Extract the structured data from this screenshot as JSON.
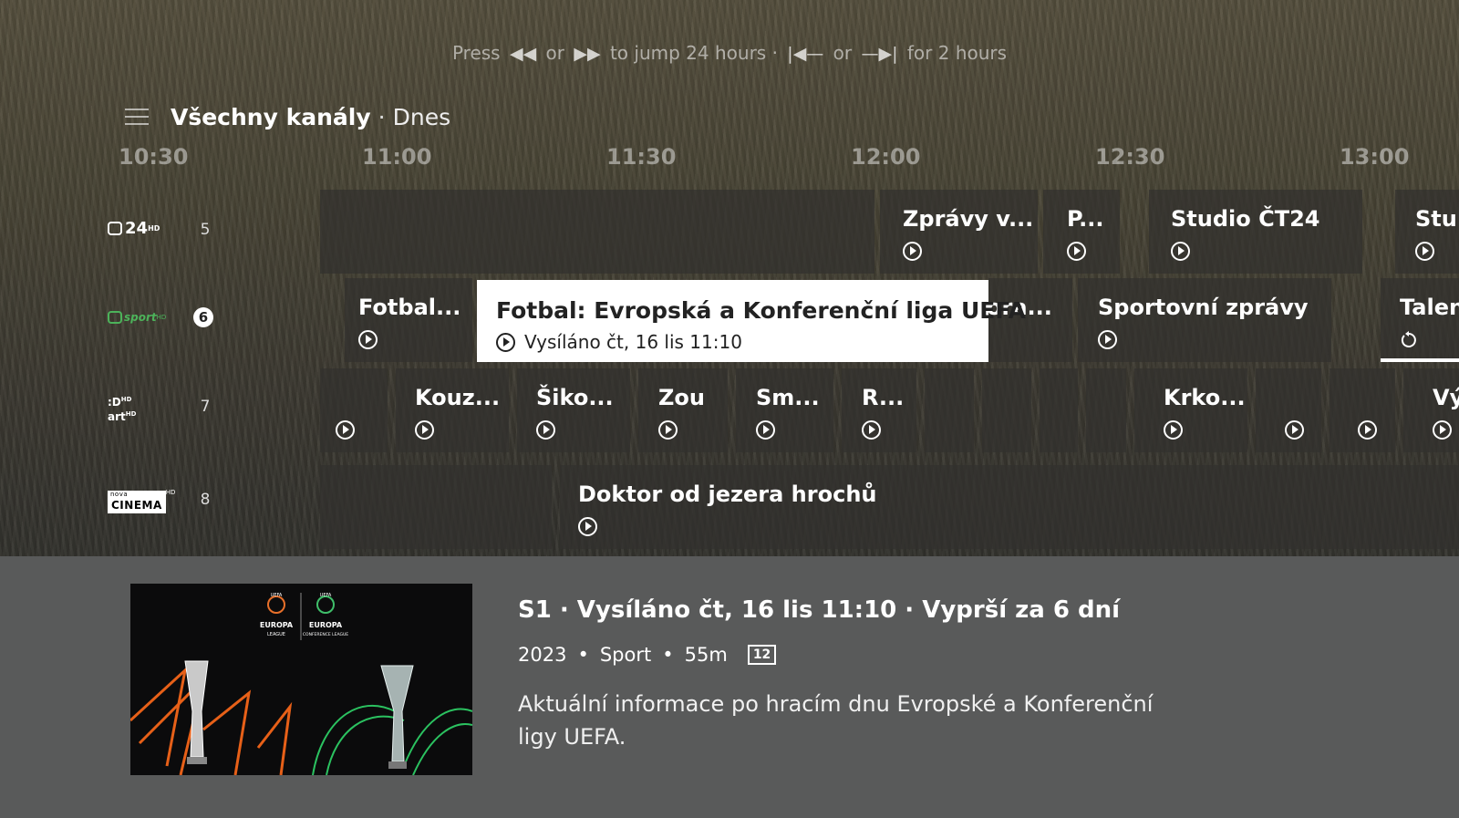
{
  "hint": {
    "press": "Press",
    "rewind_glyph": "◀◀",
    "or1": "or",
    "ffwd_glyph": "▶▶",
    "jump24": "to jump 24 hours",
    "dot": "·",
    "prev_glyph": "|◀—",
    "or2": "or",
    "next_glyph": "—▶|",
    "for2": "for 2 hours"
  },
  "header": {
    "title": "Všechny kanály",
    "separator": "·",
    "day": "Dnes"
  },
  "timeline": [
    "10:30",
    "11:00",
    "11:30",
    "12:00",
    "12:30",
    "13:00"
  ],
  "channels": [
    {
      "logo_text": "24",
      "logo_sup": "HD",
      "number": "5",
      "programs": [
        {
          "title": "",
          "play": false
        },
        {
          "title": "Zprávy v...",
          "play": true
        },
        {
          "title": "P...",
          "play": true
        },
        {
          "title": "Studio ČT24",
          "play": true
        },
        {
          "title": "Stu",
          "play": true
        }
      ]
    },
    {
      "logo_text": "sport",
      "logo_sup": "HD",
      "number": "6",
      "programs": [
        {
          "title": "Fotbal...",
          "play": true
        },
        {
          "title": "ora...",
          "play": false
        },
        {
          "title": "Sportovní zprávy",
          "play": true
        },
        {
          "title": "Talen",
          "play": false,
          "replay": true
        }
      ]
    },
    {
      "logo_text": ":D",
      "logo_text2": "art",
      "logo_sup": "HD",
      "number": "7",
      "programs": [
        {
          "title": "",
          "play": true
        },
        {
          "title": "Kouz...",
          "play": true
        },
        {
          "title": "Šiko...",
          "play": true
        },
        {
          "title": "Zou",
          "play": true
        },
        {
          "title": "Sm...",
          "play": true
        },
        {
          "title": "R...",
          "play": true
        },
        {
          "title": "",
          "play": false
        },
        {
          "title": "",
          "play": false
        },
        {
          "title": "",
          "play": false
        },
        {
          "title": "",
          "play": false
        },
        {
          "title": "Krko...",
          "play": true
        },
        {
          "title": "",
          "play": true
        },
        {
          "title": "",
          "play": true
        },
        {
          "title": "Vý",
          "play": true
        }
      ]
    },
    {
      "logo_text": "CINEMA",
      "logo_small": "nova",
      "logo_sup": "HD",
      "number": "8",
      "programs": [
        {
          "title": "",
          "play": false
        },
        {
          "title": "Doktor od jezera hrochů",
          "play": true
        }
      ]
    }
  ],
  "focused": {
    "title": "Fotbal: Evropská a Konferenční liga UEFA",
    "subtitle": "Vysíláno čt, 16 lis 11:10"
  },
  "detail": {
    "line1": "S1 · Vysíláno čt, 16 lis 11:10 · Vyprší za 6 dní",
    "year": "2023",
    "genre": "Sport",
    "duration": "55m",
    "dot": "•",
    "rating": "12",
    "description": "Aktuální informace po hracím dnu Evropské a Konferenční ligy UEFA.",
    "thumb_logo1": "EUROPA",
    "thumb_logo1_sub": "LEAGUE",
    "thumb_logo2": "EUROPA",
    "thumb_logo2_sub": "CONFERENCE LEAGUE",
    "thumb_uefa": "UEFA"
  },
  "colors": {
    "focus_bg": "#ffffff",
    "sport_green": "#4cb35a",
    "detail_bg": "#595a5a"
  }
}
